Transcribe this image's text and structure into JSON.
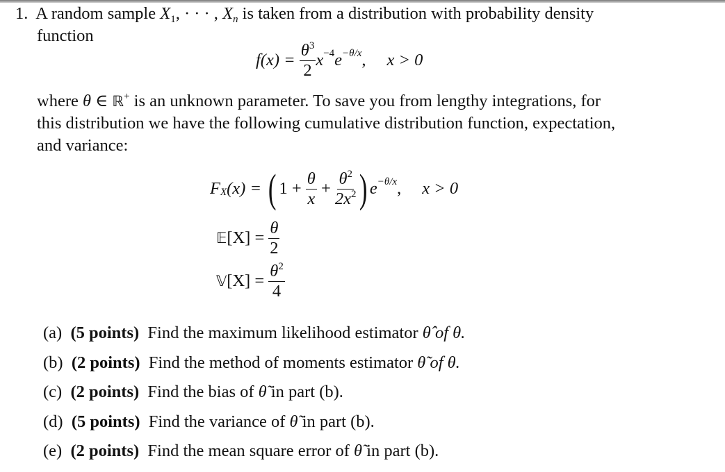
{
  "problem": {
    "number": "1.",
    "intro_line1": {
      "pre": "A random sample",
      "var_start": "X",
      "sub_start": "1",
      "sep": ", · · · ,",
      "var_end": "X",
      "sub_end": "n",
      "post": "is taken from a distribution with probability density"
    },
    "intro_line2": "function",
    "pdf": {
      "lhs": "f(x) =",
      "num": "θ",
      "num_exp": "3",
      "den": "2",
      "x": "x",
      "x_exp": "−4",
      "e": "e",
      "e_exp": "−θ/x",
      "comma": ",",
      "cond": "x > 0"
    },
    "para_line1": {
      "pre": "where",
      "theta": "θ",
      "in": "∈",
      "R": "ℝ",
      "R_sup": "+",
      "post": "is an unknown parameter.  To save you from lengthy integrations, for"
    },
    "para_line2": "this distribution we have the following cumulative distribution function, expectation,",
    "para_line3": "and variance:",
    "cdf": {
      "F": "F",
      "F_sub": "X",
      "arg": "(x) =",
      "lparen": "(",
      "one": "1 +",
      "f1_num": "θ",
      "f1_den": "x",
      "plus": "+",
      "f2_num": "θ",
      "f2_num_exp": "2",
      "f2_den": "2x",
      "f2_den_exp": "2",
      "rparen": ")",
      "e": "e",
      "e_exp": "−θ/x",
      "comma": ",",
      "cond": "x > 0"
    },
    "expectation": {
      "lhs_E": "𝔼",
      "lhs_arg": "[X] =",
      "num": "θ",
      "den": "2"
    },
    "variance": {
      "lhs_V": "𝕍",
      "lhs_arg": "[X] =",
      "num": "θ",
      "num_exp": "2",
      "den": "4"
    },
    "parts": [
      {
        "label": "(a)",
        "points": "(5 points)",
        "text_pre": "Find the maximum likelihood estimator",
        "estimator": "θ̂",
        "text_post": "of θ."
      },
      {
        "label": "(b)",
        "points": "(2 points)",
        "text_pre": "Find the method of moments estimator",
        "estimator": "θ̃",
        "text_post": "of θ."
      },
      {
        "label": "(c)",
        "points": "(2 points)",
        "text_pre": "Find the bias of",
        "estimator": "θ̃",
        "text_post": "in part (b)."
      },
      {
        "label": "(d)",
        "points": "(5 points)",
        "text_pre": "Find the variance of",
        "estimator": "θ̃",
        "text_post": "in part (b)."
      },
      {
        "label": "(e)",
        "points": "(2 points)",
        "text_pre": "Find the mean square error of",
        "estimator": "θ̃",
        "text_post": "in part (b)."
      }
    ]
  }
}
